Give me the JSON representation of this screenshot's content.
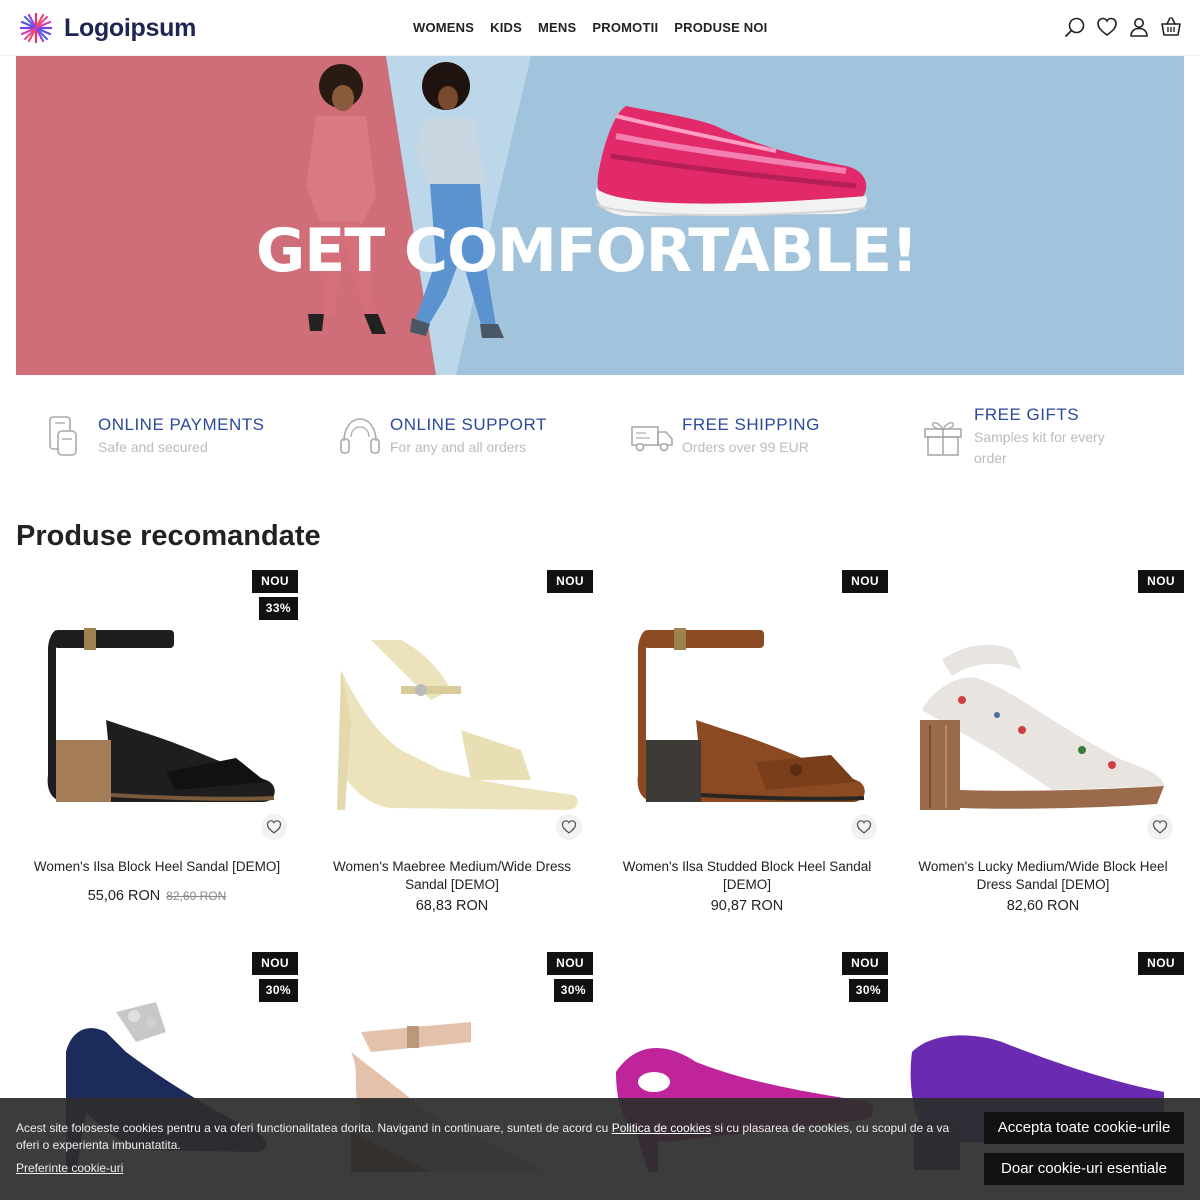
{
  "brand": {
    "name": "Logoipsum"
  },
  "nav": [
    "WOMENS",
    "KIDS",
    "MENS",
    "PROMOTII",
    "PRODUSE NOI"
  ],
  "header_icons": [
    "search-icon",
    "heart-icon",
    "user-icon",
    "basket-icon"
  ],
  "hero": {
    "title": "GET COMFORTABLE!"
  },
  "features": [
    {
      "icon": "card-payment-icon",
      "title": "ONLINE PAYMENTS",
      "subtitle": "Safe and secured"
    },
    {
      "icon": "headset-icon",
      "title": "ONLINE SUPPORT",
      "subtitle": "For any and all orders"
    },
    {
      "icon": "truck-icon",
      "title": "FREE SHIPPING",
      "subtitle": "Orders over 99 EUR"
    },
    {
      "icon": "gift-icon",
      "title": "FREE GIFTS",
      "subtitle": "Samples kit for every order"
    }
  ],
  "section_title": "Produse recomandate",
  "products": [
    {
      "badge": "NOU",
      "discount": "33%",
      "name": "Women's Ilsa Block Heel Sandal [DEMO]",
      "price": "55,06 RON",
      "old_price": "82,60 RON",
      "color": "#1e1e1e"
    },
    {
      "badge": "NOU",
      "discount": "",
      "name": "Women's Maebree Medium/Wide Dress Sandal [DEMO]",
      "price": "68,83 RON",
      "old_price": "",
      "color": "#ece3bd"
    },
    {
      "badge": "NOU",
      "discount": "",
      "name": "Women's Ilsa Studded Block Heel Sandal [DEMO]",
      "price": "90,87 RON",
      "old_price": "",
      "color": "#8b4a22"
    },
    {
      "badge": "NOU",
      "discount": "",
      "name": "Women's Lucky Medium/Wide Block Heel Dress Sandal [DEMO]",
      "price": "82,60 RON",
      "old_price": "",
      "color": "#e8e4e0"
    },
    {
      "badge": "NOU",
      "discount": "30%",
      "color": "#1c2a5c"
    },
    {
      "badge": "NOU",
      "discount": "30%",
      "color": "#e3c1aa"
    },
    {
      "badge": "NOU",
      "discount": "30%",
      "color": "#c0249a"
    },
    {
      "badge": "NOU",
      "discount": "",
      "color": "#6a2bb0"
    }
  ],
  "cookie": {
    "text_before": "Acest site foloseste cookies pentru a va oferi functionalitatea dorita. Navigand in continuare, sunteti de acord cu ",
    "policy_link": "Politica de cookies",
    "text_after": " si cu plasarea de cookies, cu scopul de a va oferi o experienta imbunatatita.",
    "preferences": "Preferinte cookie-uri",
    "accept_all": "Accepta toate cookie-urile",
    "essential_only": "Doar cookie-uri esentiale"
  }
}
